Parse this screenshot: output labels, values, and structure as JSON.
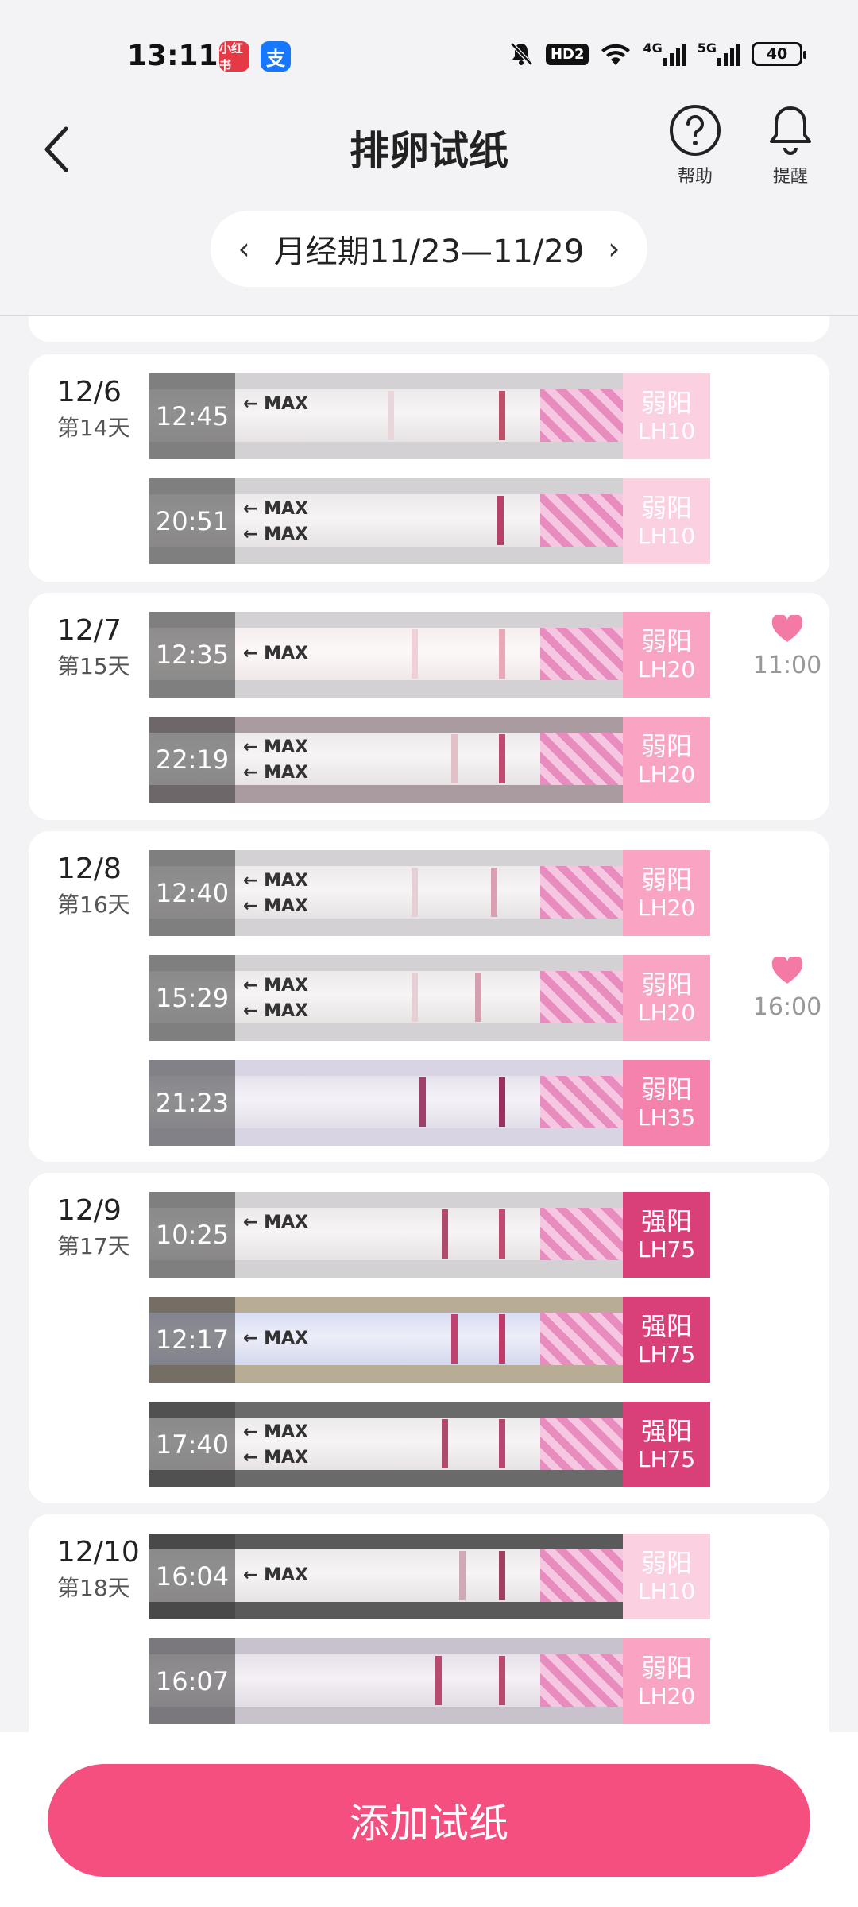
{
  "status_bar": {
    "time": "13:11",
    "app_badge_1": "小红书",
    "app_badge_2": "支",
    "hd_label": "HD2",
    "net_1": "4G",
    "net_2": "5G",
    "battery": "40"
  },
  "header": {
    "title": "排卵试纸",
    "help_label": "帮助",
    "remind_label": "提醒",
    "period_label": "月经期11/23—11/29",
    "prev_icon": "‹",
    "next_icon": "›"
  },
  "max_label": "← MAX",
  "days": [
    {
      "date": "12/6",
      "day": "第14天",
      "tests": [
        {
          "time": "12:45",
          "result": "弱阳",
          "value": "LH10"
        },
        {
          "time": "20:51",
          "result": "弱阳",
          "value": "LH10"
        }
      ]
    },
    {
      "date": "12/7",
      "day": "第15天",
      "intercourse_time": "11:00",
      "tests": [
        {
          "time": "12:35",
          "result": "弱阳",
          "value": "LH20"
        },
        {
          "time": "22:19",
          "result": "弱阳",
          "value": "LH20"
        }
      ]
    },
    {
      "date": "12/8",
      "day": "第16天",
      "intercourse_time": "16:00",
      "tests": [
        {
          "time": "12:40",
          "result": "弱阳",
          "value": "LH20"
        },
        {
          "time": "15:29",
          "result": "弱阳",
          "value": "LH20"
        },
        {
          "time": "21:23",
          "result": "弱阳",
          "value": "LH35"
        }
      ]
    },
    {
      "date": "12/9",
      "day": "第17天",
      "tests": [
        {
          "time": "10:25",
          "result": "强阳",
          "value": "LH75"
        },
        {
          "time": "12:17",
          "result": "强阳",
          "value": "LH75"
        },
        {
          "time": "17:40",
          "result": "强阳",
          "value": "LH75"
        }
      ]
    },
    {
      "date": "12/10",
      "day": "第18天",
      "tests": [
        {
          "time": "16:04",
          "result": "弱阳",
          "value": "LH10"
        },
        {
          "time": "16:07",
          "result": "弱阳",
          "value": "LH20"
        }
      ]
    }
  ],
  "add_button": "添加试纸",
  "colors": {
    "accent": "#f54f80",
    "weak_light": "#fbd0e0",
    "weak_mid": "#f8a4c2",
    "weak_strong": "#f582ac",
    "strong": "#d93f78",
    "heart": "#f47aa6"
  }
}
